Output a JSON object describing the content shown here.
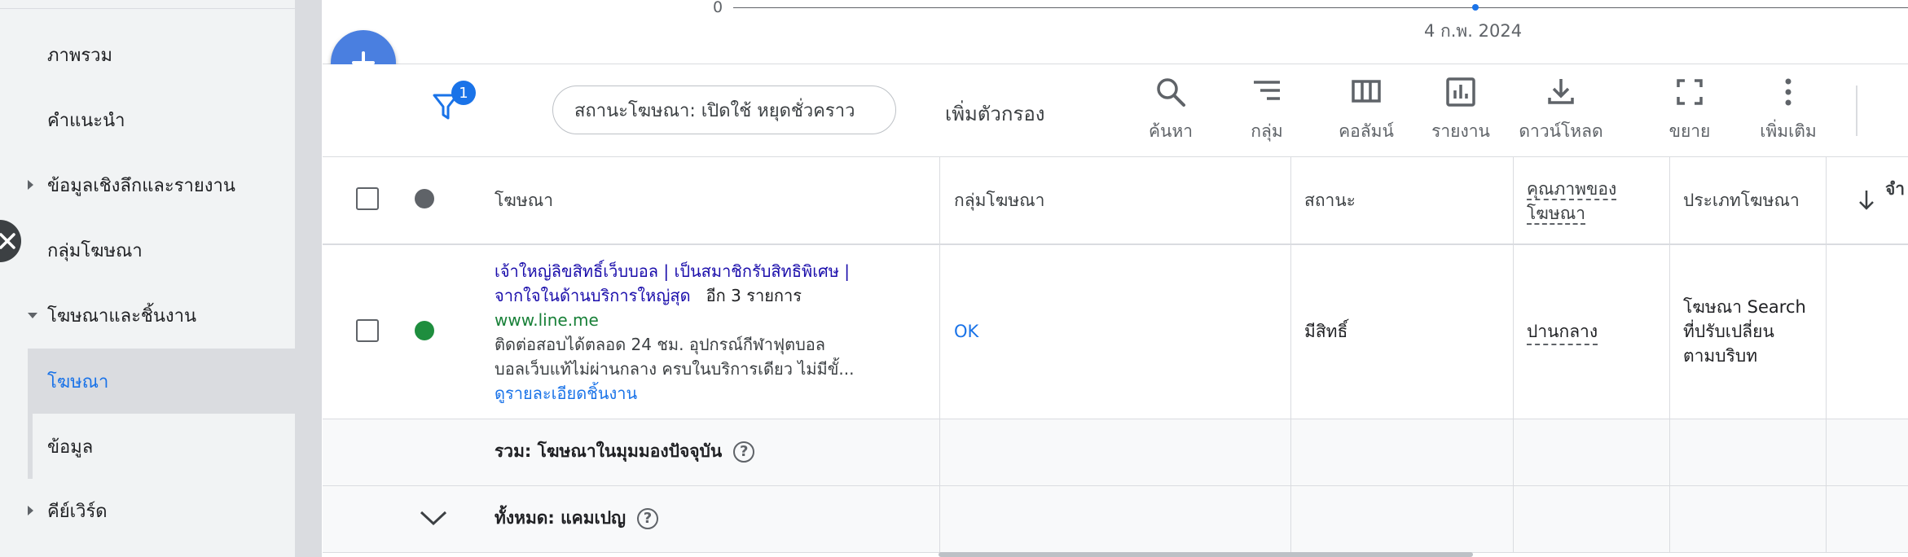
{
  "sidebar": {
    "items": [
      {
        "label": "ภาพรวม"
      },
      {
        "label": "คำแนะนำ"
      },
      {
        "label": "ข้อมูลเชิงลึกและรายงาน"
      },
      {
        "label": "กลุ่มโฆษณา"
      },
      {
        "label": "โฆษณาและชิ้นงาน"
      },
      {
        "label": "โฆษณา"
      },
      {
        "label": "ข้อมูล"
      },
      {
        "label": "คีย์เวิร์ด"
      }
    ]
  },
  "chart": {
    "y_zero": "0",
    "date_label": "4 ก.พ. 2024"
  },
  "toolbar": {
    "filter_count": "1",
    "filter_chip": "สถานะโฆษณา: เปิดใช้ หยุดชั่วคราว",
    "add_filter": "เพิ่มตัวกรอง",
    "tools": [
      {
        "label": "ค้นหา",
        "icon": "search-icon"
      },
      {
        "label": "กลุ่ม",
        "icon": "segment-icon"
      },
      {
        "label": "คอลัมน์",
        "icon": "columns-icon"
      },
      {
        "label": "รายงาน",
        "icon": "reports-icon"
      },
      {
        "label": "ดาวน์โหลด",
        "icon": "download-icon"
      },
      {
        "label": "ขยาย",
        "icon": "expand-icon"
      },
      {
        "label": "เพิ่มเติม",
        "icon": "more-icon"
      }
    ]
  },
  "table": {
    "headers": {
      "ad": "โฆษณา",
      "ad_group": "กลุ่มโฆษณา",
      "status": "สถานะ",
      "ad_strength_line1": "คุณภาพของ",
      "ad_strength_line2": "โฆษณา",
      "ad_type": "ประเภทโฆษณา",
      "next_col": "จำ"
    },
    "row": {
      "headline_1": "เจ้าใหญ่ลิขสิทธิ์เว็บบอล | เป็นสมาชิกรับสิทธิพิเศษ |",
      "headline_2": "จากใจในด้านบริการใหญ่สุด",
      "more": "อีก 3 รายการ",
      "url": "www.line.me",
      "desc_1": "ติดต่อสอบได้ตลอด 24 ชม. อุปกรณ์กีฬาฟุตบอล",
      "desc_2": "บอลเว็บแท้ไม่ผ่านกลาง ครบในบริการเดียว ไม่มีขั้...",
      "details": "ดูรายละเอียดชิ้นงาน",
      "ad_group": "OK",
      "status": "มีสิทธิ์",
      "ad_strength": "ปานกลาง",
      "ad_type_1": "โฆษณา Search",
      "ad_type_2": "ที่ปรับเปลี่ยน",
      "ad_type_3": "ตามบริบท"
    },
    "total_current": "รวม: โฆษณาในมุมมองปัจจุบัน",
    "total_campaign": "ทั้งหมด: แคมเปญ"
  },
  "colors": {
    "accent": "#1a73e8",
    "fab": "#4a7fe0",
    "status_green": "#1e8e3e",
    "headline": "#1a0dab",
    "url_green": "#188038"
  }
}
